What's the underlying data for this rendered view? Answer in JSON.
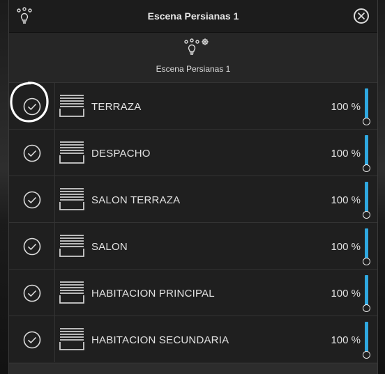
{
  "dialog": {
    "title": "Escena Persianas 1",
    "title_icon": "scene-bulbs-icon",
    "close_icon": "close-icon"
  },
  "scene": {
    "name": "Escena Persianas 1",
    "icon": "scene-bulbs-gear-icon"
  },
  "items": [
    {
      "label": "TERRAZA",
      "value": "100 %",
      "checked": true,
      "level": 1.0
    },
    {
      "label": "DESPACHO",
      "value": "100 %",
      "checked": true,
      "level": 1.0
    },
    {
      "label": "SALON TERRAZA",
      "value": "100 %",
      "checked": true,
      "level": 1.0
    },
    {
      "label": "SALON",
      "value": "100 %",
      "checked": true,
      "level": 1.0
    },
    {
      "label": "HABITACION PRINCIPAL",
      "value": "100 %",
      "checked": true,
      "level": 1.0
    },
    {
      "label": "HABITACION SECUNDARIA",
      "value": "100 %",
      "checked": true,
      "level": 1.0
    }
  ],
  "colors": {
    "accent": "#2fa8e0",
    "background": "#252525",
    "row": "#1f1f1f"
  }
}
